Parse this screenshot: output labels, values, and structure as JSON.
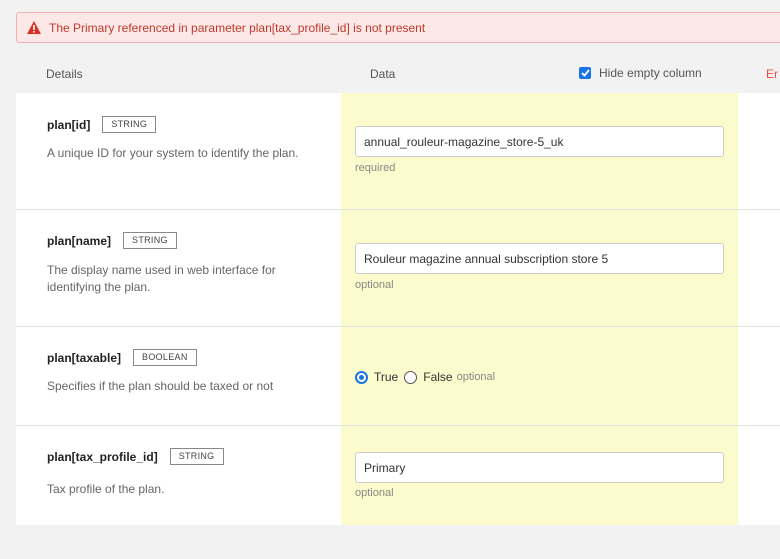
{
  "alert": {
    "message": "The Primary referenced in parameter plan[tax_profile_id] is not present"
  },
  "columns": {
    "details": "Details",
    "data": "Data",
    "hide_empty": "Hide empty column",
    "hide_empty_checked": true,
    "errors_partial": "Er"
  },
  "params": [
    {
      "name": "plan[id]",
      "type": "STRING",
      "description": "A unique ID for your system to identify the plan.",
      "value": "annual_rouleur-magazine_store-5_uk",
      "hint": "required"
    },
    {
      "name": "plan[name]",
      "type": "STRING",
      "description": "The display name used in web interface for identifying the plan.",
      "value": "Rouleur magazine annual subscription store 5",
      "hint": "optional"
    },
    {
      "name": "plan[taxable]",
      "type": "BOOLEAN",
      "description": "Specifies if the plan should be taxed or not",
      "true_label": "True",
      "false_label": "False",
      "selected": "True",
      "hint": "optional"
    },
    {
      "name": "plan[tax_profile_id]",
      "type": "STRING",
      "description": "Tax profile of the plan.",
      "value": "Primary",
      "hint": "optional"
    }
  ],
  "colors": {
    "alert_text": "#c0392b",
    "alert_bg": "#fde8e8",
    "data_column_bg": "#fbfbcd",
    "accent": "#1a73e8"
  },
  "icons": {
    "alert": "warning-triangle-icon",
    "checkbox": "checkbox-checked-icon"
  }
}
